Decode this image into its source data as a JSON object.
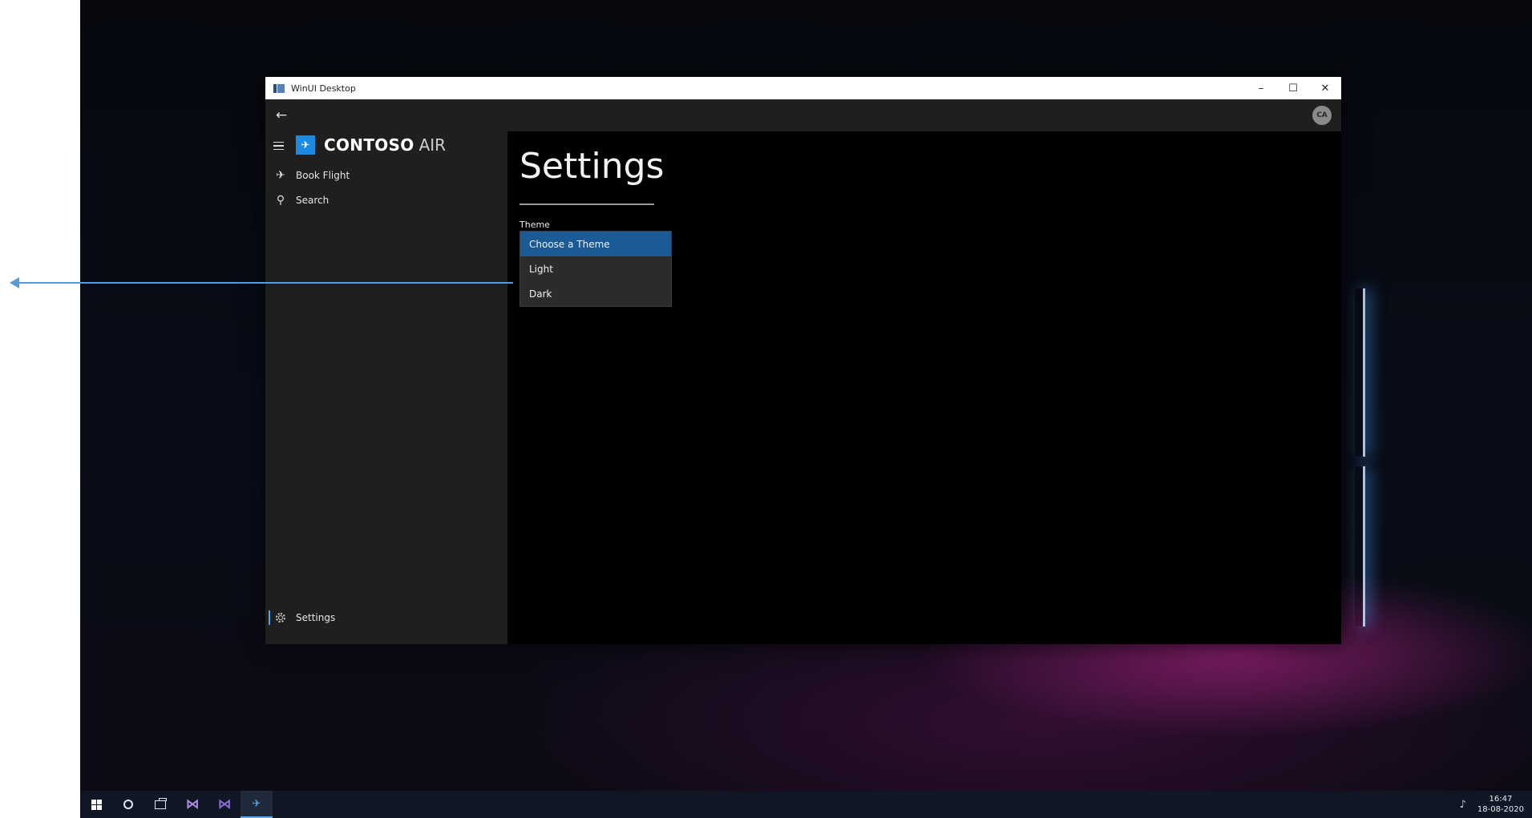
{
  "window": {
    "title": "WinUI Desktop",
    "minimize_glyph": "–",
    "maximize_glyph": "☐",
    "close_glyph": "✕"
  },
  "topbar": {
    "back_glyph": "←",
    "avatar_initials": "CA"
  },
  "brand": {
    "logo_glyph": "✈",
    "name": "CONTOSO",
    "suffix": "AIR"
  },
  "nav": {
    "items": [
      {
        "label": "Book Flight",
        "icon": "airplane-icon",
        "glyph": "✈"
      },
      {
        "label": "Search",
        "icon": "search-icon",
        "glyph": "⚲"
      }
    ],
    "footer": {
      "label": "Settings",
      "icon": "gear-icon",
      "selected": true
    }
  },
  "content": {
    "title": "Settings",
    "theme_label": "Theme",
    "theme_options": [
      {
        "label": "Choose a Theme",
        "selected": true
      },
      {
        "label": "Light",
        "selected": false
      },
      {
        "label": "Dark",
        "selected": false
      }
    ]
  },
  "taskbar": {
    "vs_glyph": "⋈",
    "active_app_glyph": "✈",
    "tray_glyph": "♪",
    "time": "16:47",
    "date": "18-08-2020"
  },
  "colors": {
    "accent": "#1c8ae0",
    "selection": "#1a5a96",
    "annotation_arrow": "#5b9bd5",
    "sidebar_bg": "#1f1f1f",
    "content_bg": "#000000"
  }
}
